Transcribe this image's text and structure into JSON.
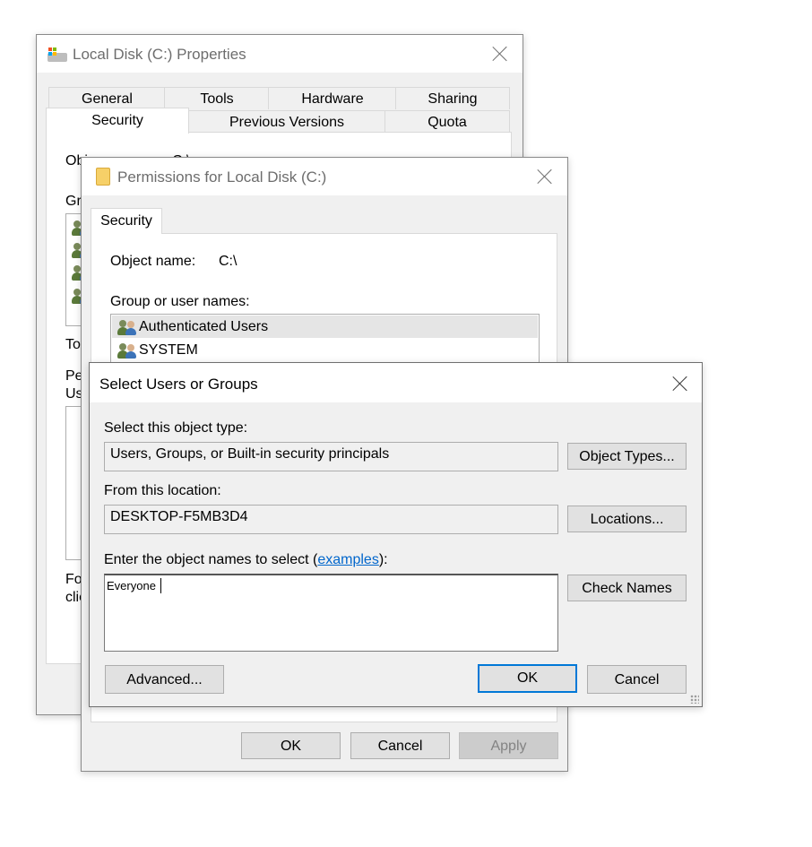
{
  "props": {
    "title": "Local Disk (C:) Properties",
    "tabs_row1": [
      "General",
      "Tools",
      "Hardware",
      "Sharing"
    ],
    "tabs_row2": [
      "Security",
      "Previous Versions",
      "Quota"
    ],
    "partial": {
      "obj": "Obj",
      "obj_val": "C:\\",
      "gr": "Gr",
      "to": "To",
      "pe": "Pe",
      "us": "Us",
      "fo": "Fo",
      "cli": "clic"
    }
  },
  "perms": {
    "title": "Permissions for Local Disk (C:)",
    "tab": "Security",
    "object_name_label": "Object name:",
    "object_name_value": "C:\\",
    "group_label": "Group or user names:",
    "users": [
      "Authenticated Users",
      "SYSTEM"
    ],
    "ok": "OK",
    "cancel": "Cancel",
    "apply": "Apply"
  },
  "select": {
    "title": "Select Users or Groups",
    "object_type_label": "Select this object type:",
    "object_type_value": "Users, Groups, or Built-in security principals",
    "object_types_btn": "Object Types...",
    "location_label": "From this location:",
    "location_value": "DESKTOP-F5MB3D4",
    "locations_btn": "Locations...",
    "enter_label_pre": "Enter the object names to select (",
    "enter_label_link": "examples",
    "enter_label_post": "):",
    "names_value": "Everyone",
    "check_names_btn": "Check Names",
    "advanced_btn": "Advanced...",
    "ok_btn": "OK",
    "cancel_btn": "Cancel"
  }
}
